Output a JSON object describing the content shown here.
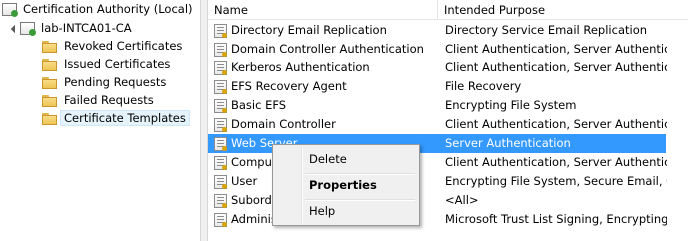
{
  "tree": {
    "root_label": "Certification Authority (Local)",
    "ca_label": "lab-INTCA01-CA",
    "folders": [
      {
        "label": "Revoked Certificates"
      },
      {
        "label": "Issued Certificates"
      },
      {
        "label": "Pending Requests"
      },
      {
        "label": "Failed Requests"
      },
      {
        "label": "Certificate Templates"
      }
    ]
  },
  "list": {
    "columns": {
      "name": "Name",
      "purpose": "Intended Purpose"
    },
    "rows": [
      {
        "name": "Directory Email Replication",
        "purpose": "Directory Service Email Replication"
      },
      {
        "name": "Domain Controller Authentication",
        "purpose": "Client Authentication, Server Authentic..."
      },
      {
        "name": "Kerberos Authentication",
        "purpose": "Client Authentication, Server Authentic..."
      },
      {
        "name": "EFS Recovery Agent",
        "purpose": "File Recovery"
      },
      {
        "name": "Basic EFS",
        "purpose": "Encrypting File System"
      },
      {
        "name": "Domain Controller",
        "purpose": "Client Authentication, Server Authentic..."
      },
      {
        "name": "Web Server",
        "purpose": "Server Authentication"
      },
      {
        "name": "Comput",
        "purpose": "Client Authentication, Server Authentic..."
      },
      {
        "name": "User",
        "purpose": "Encrypting File System, Secure Email, Cl..."
      },
      {
        "name": "Subordi",
        "purpose": "<All>"
      },
      {
        "name": "Adminis",
        "purpose": "Microsoft Trust List Signing, Encrypting..."
      }
    ]
  },
  "context_menu": {
    "items": [
      {
        "label": "Delete"
      },
      {
        "label": "Properties"
      },
      {
        "label": "Help"
      }
    ]
  },
  "colors": {
    "selection": "#3399ff",
    "tree_selection": "#e5f3fb"
  }
}
